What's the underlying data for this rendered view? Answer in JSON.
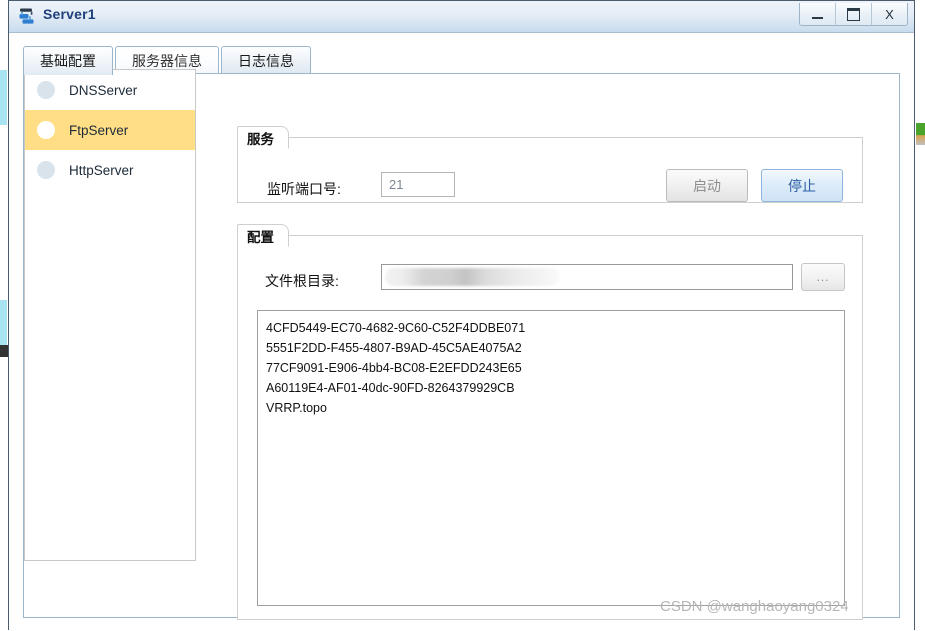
{
  "window": {
    "title": "Server1",
    "icon": "server-device-icon",
    "controls": {
      "minimize": "–",
      "maximize": "❐",
      "close": "X"
    }
  },
  "tabs": [
    {
      "label": "基础配置",
      "state": "active"
    },
    {
      "label": "服务器信息",
      "state": "inactive"
    },
    {
      "label": "日志信息",
      "state": "inactive"
    }
  ],
  "sidebar": {
    "items": [
      {
        "label": "DNSServer",
        "selected": false
      },
      {
        "label": "FtpServer",
        "selected": true
      },
      {
        "label": "HttpServer",
        "selected": false
      }
    ]
  },
  "service_group": {
    "title": "服务",
    "port_label": "监听端口号:",
    "port_value": "21",
    "port_placeholder": "",
    "start_button": "启动",
    "stop_button": "停止"
  },
  "config_group": {
    "title": "配置",
    "root_label": "文件根目录:",
    "root_value": "",
    "root_placeholder": "",
    "browse_button": "...",
    "files": [
      "4CFD5449-EC70-4682-9C60-C52F4DDBE071",
      "5551F2DD-F455-4807-B9AD-45C5AE4075A2",
      "77CF9091-E906-4bb4-BC08-E2EFDD243E65",
      "A60119E4-AF01-40dc-90FD-8264379929CB",
      "VRRP.topo"
    ]
  },
  "watermark": "CSDN @wanghaoyang0324",
  "colors": {
    "titlebar_text": "#1f3f7a",
    "selection": "#ffde85",
    "primary_button_text": "#2a5fa3",
    "disabled_text": "#8e8e8e"
  }
}
